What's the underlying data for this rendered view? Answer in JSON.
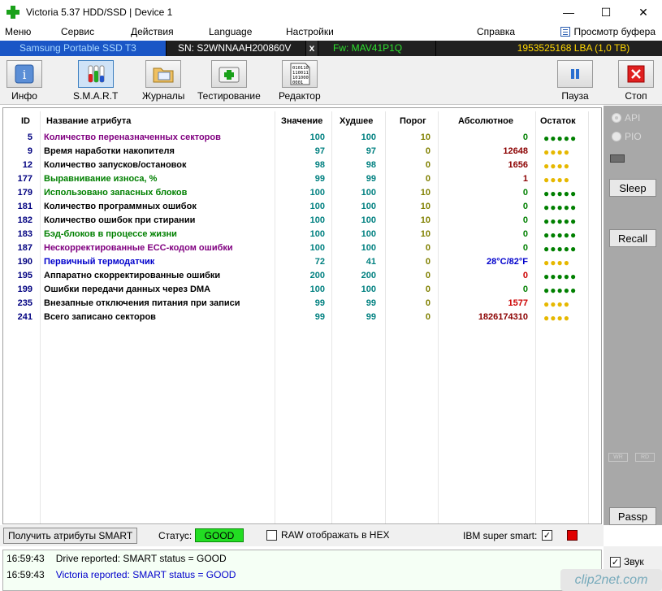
{
  "window": {
    "title": "Victoria 5.37 HDD/SSD | Device 1",
    "min": "—",
    "max": "☐",
    "close": "✕"
  },
  "menu": {
    "items": [
      "Меню",
      "Сервис",
      "Действия",
      "Language",
      "Настройки",
      "Справка"
    ],
    "buffer": "Просмотр буфера"
  },
  "device": {
    "model": "Samsung Portable SSD T3",
    "sn": "SN: S2WNNAAH200860V",
    "x": "x",
    "fw": "Fw: MAV41P1Q",
    "lba": "1953525168 LBA (1,0 TB)"
  },
  "toolbar": {
    "info": "Инфо",
    "smart": "S.M.A.R.T",
    "logs": "Журналы",
    "test": "Тестирование",
    "editor": "Редактор",
    "pause": "Пауза",
    "stop": "Стоп",
    "editor_icon_text": "010110\n110011\n101000\n0001"
  },
  "table": {
    "headers": {
      "id": "ID",
      "name": "Название атрибута",
      "value": "Значение",
      "worst": "Худшее",
      "threshold": "Порог",
      "raw": "Абсолютное",
      "remain": "Остаток"
    },
    "rows": [
      {
        "id": "5",
        "name": "Количество переназначенных секторов",
        "value": "100",
        "worst": "100",
        "threshold": "10",
        "raw": "0",
        "dots": "●●●●●",
        "name_color": "#800080",
        "raw_color": "#008000",
        "dots_color": "#008000"
      },
      {
        "id": "9",
        "name": "Время наработки накопителя",
        "value": "97",
        "worst": "97",
        "threshold": "0",
        "raw": "12648",
        "dots": "●●●●",
        "name_color": "#000000",
        "raw_color": "#8b0000",
        "dots_color": "#e6b800"
      },
      {
        "id": "12",
        "name": "Количество запусков/остановок",
        "value": "98",
        "worst": "98",
        "threshold": "0",
        "raw": "1656",
        "dots": "●●●●",
        "name_color": "#000000",
        "raw_color": "#8b0000",
        "dots_color": "#e6b800"
      },
      {
        "id": "177",
        "name": "Выравнивание износа, %",
        "value": "99",
        "worst": "99",
        "threshold": "0",
        "raw": "1",
        "dots": "●●●●",
        "name_color": "#008000",
        "raw_color": "#8b0000",
        "dots_color": "#e6b800"
      },
      {
        "id": "179",
        "name": "Использовано запасных блоков",
        "value": "100",
        "worst": "100",
        "threshold": "10",
        "raw": "0",
        "dots": "●●●●●",
        "name_color": "#008000",
        "raw_color": "#008000",
        "dots_color": "#008000"
      },
      {
        "id": "181",
        "name": "Количество программных ошибок",
        "value": "100",
        "worst": "100",
        "threshold": "10",
        "raw": "0",
        "dots": "●●●●●",
        "name_color": "#000000",
        "raw_color": "#008000",
        "dots_color": "#008000"
      },
      {
        "id": "182",
        "name": "Количество ошибок при стирании",
        "value": "100",
        "worst": "100",
        "threshold": "10",
        "raw": "0",
        "dots": "●●●●●",
        "name_color": "#000000",
        "raw_color": "#008000",
        "dots_color": "#008000"
      },
      {
        "id": "183",
        "name": "Бэд-блоков в процессе жизни",
        "value": "100",
        "worst": "100",
        "threshold": "10",
        "raw": "0",
        "dots": "●●●●●",
        "name_color": "#008000",
        "raw_color": "#008000",
        "dots_color": "#008000"
      },
      {
        "id": "187",
        "name": "Нескорректированные ECC-кодом ошибки",
        "value": "100",
        "worst": "100",
        "threshold": "0",
        "raw": "0",
        "dots": "●●●●●",
        "name_color": "#800080",
        "raw_color": "#008000",
        "dots_color": "#008000"
      },
      {
        "id": "190",
        "name": "Первичный термодатчик",
        "value": "72",
        "worst": "41",
        "threshold": "0",
        "raw": "28°C/82°F",
        "dots": "●●●●",
        "name_color": "#0000cc",
        "raw_color": "#0000cc",
        "dots_color": "#e6b800"
      },
      {
        "id": "195",
        "name": "Аппаратно скорректированные ошибки",
        "value": "200",
        "worst": "200",
        "threshold": "0",
        "raw": "0",
        "dots": "●●●●●",
        "name_color": "#000000",
        "raw_color": "#cc0000",
        "dots_color": "#008000"
      },
      {
        "id": "199",
        "name": "Ошибки передачи данных через DMA",
        "value": "100",
        "worst": "100",
        "threshold": "0",
        "raw": "0",
        "dots": "●●●●●",
        "name_color": "#000000",
        "raw_color": "#008000",
        "dots_color": "#008000"
      },
      {
        "id": "235",
        "name": "Внезапные отключения питания при записи",
        "value": "99",
        "worst": "99",
        "threshold": "0",
        "raw": "1577",
        "dots": "●●●●",
        "name_color": "#000000",
        "raw_color": "#cc0000",
        "dots_color": "#e6b800"
      },
      {
        "id": "241",
        "name": "Всего записано секторов",
        "value": "99",
        "worst": "99",
        "threshold": "0",
        "raw": "1826174310",
        "dots": "●●●●",
        "name_color": "#000000",
        "raw_color": "#8b0000",
        "dots_color": "#e6b800"
      }
    ]
  },
  "right_panel": {
    "api": "API",
    "pio": "PIO",
    "sleep": "Sleep",
    "recall": "Recall",
    "wr": "WR",
    "rd": "RD",
    "passp": "Passp",
    "sound": "Звук"
  },
  "status": {
    "get_smart": "Получить атрибуты SMART",
    "status_label": "Статус:",
    "status_value": "GOOD",
    "raw_hex": "RAW отображать в HEX",
    "ibm": "IBM super smart:",
    "ibm_checked": "✓"
  },
  "log": [
    {
      "time": "16:59:43",
      "text": "Drive reported: SMART status = GOOD",
      "color": "#000000"
    },
    {
      "time": "16:59:43",
      "text": "Victoria reported: SMART status = GOOD",
      "color": "#0000cc"
    }
  ],
  "watermark": "clip2net.com"
}
